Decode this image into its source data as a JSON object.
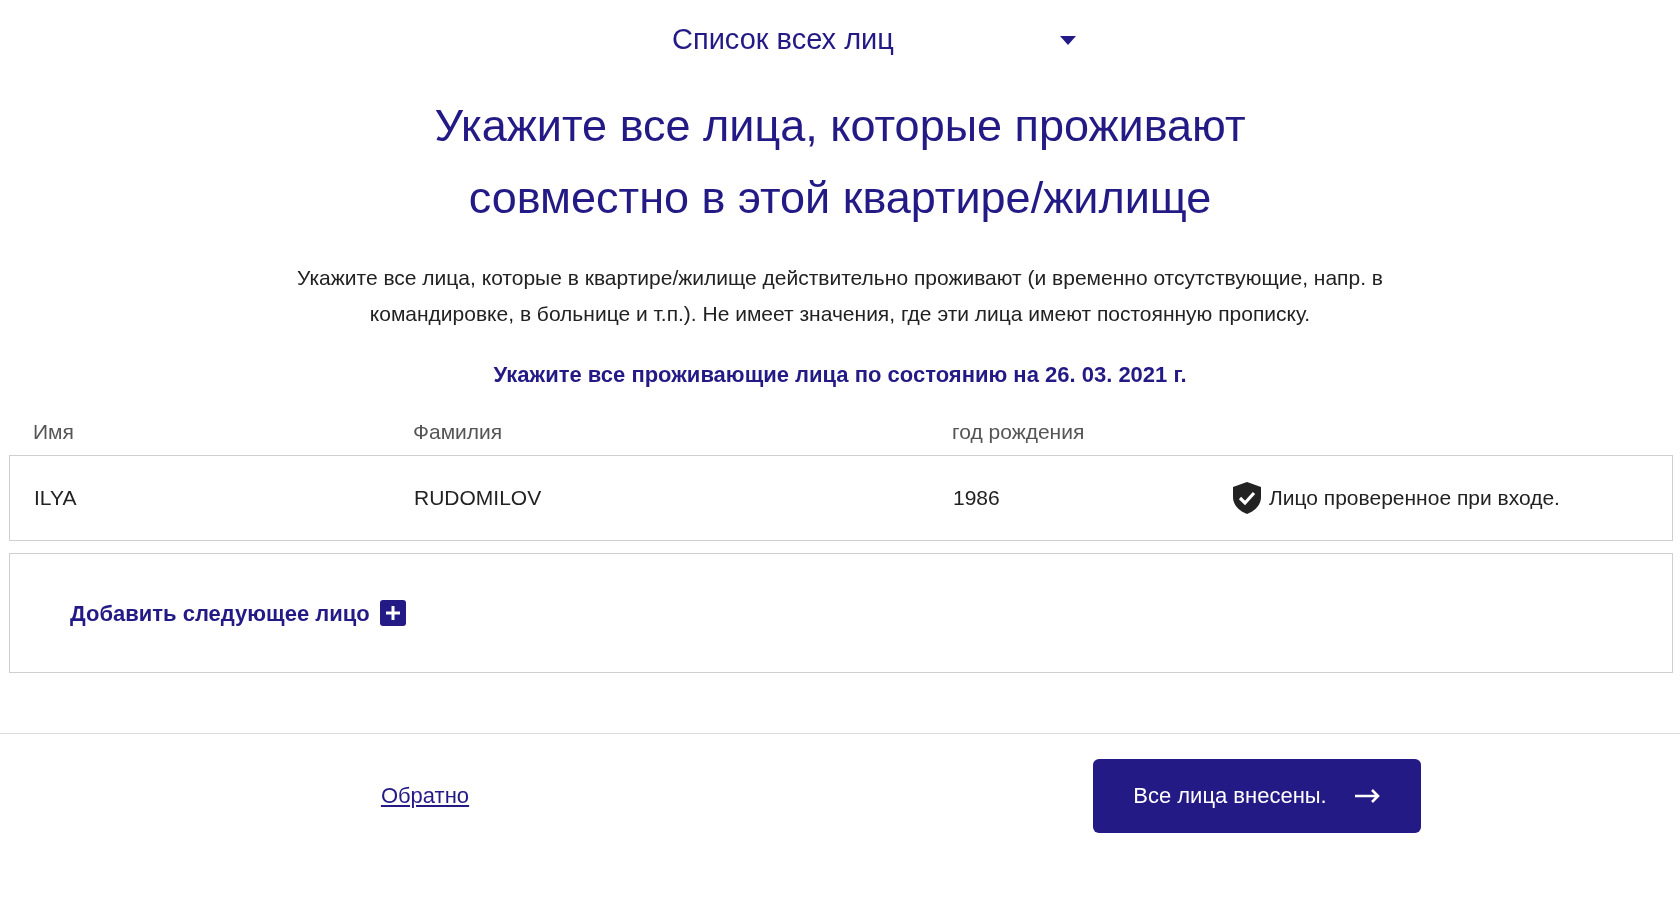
{
  "selector": {
    "label": "Список всех лиц"
  },
  "heading": "Укажите все лица, которые проживают совместно в этой квартире/жилище",
  "description": "Укажите все лица, которые в квартире/жилище действительно проживают (и временно отсутствующие, напр. в командировке, в больнице и т.п.). Не имеет значения, где эти лица имеют постоянную прописку.",
  "notice": "Укажите все проживающие лица по состоянию на 26. 03. 2021 г.",
  "table": {
    "columns": [
      "Имя",
      "Фамилия",
      "год рождения"
    ],
    "rows": [
      {
        "first_name": "ILYA",
        "last_name": "RUDOMILOV",
        "birth_year": "1986",
        "verified": true,
        "status": "Лицо проверенное при входе."
      }
    ]
  },
  "add_button": "Добавить следующее лицо",
  "footer": {
    "back_link": "Обратно",
    "submit_button": "Все лица внесены."
  }
}
